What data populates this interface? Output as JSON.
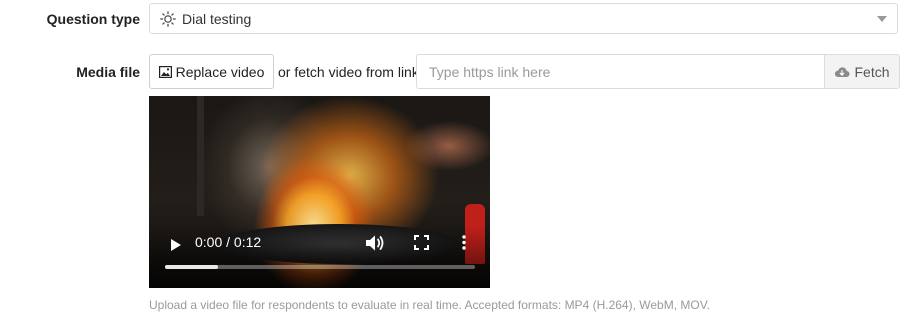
{
  "question_type": {
    "label": "Question type",
    "selected": "Dial testing",
    "icon": "dial-sun-icon"
  },
  "media_file": {
    "label": "Media file",
    "replace_button": "Replace video",
    "replace_icon": "image-icon",
    "or_text": "or fetch video from link",
    "link_placeholder": "Type https link here",
    "link_value": "",
    "fetch_button": "Fetch",
    "fetch_icon": "cloud-download-icon"
  },
  "video_player": {
    "time": "0:00 / 0:12",
    "progress": 0.17,
    "icons": [
      "play-icon",
      "volume-icon",
      "fullscreen-icon",
      "more-options-icon"
    ]
  },
  "help_text": "Upload a video file for respondents to evaluate in real time. Accepted formats: MP4 (H.264), WebM, MOV.",
  "colors": {
    "border": "#dcdcdc",
    "muted_text": "#9a9a9a",
    "fetch_bg": "#f3f3f3"
  }
}
